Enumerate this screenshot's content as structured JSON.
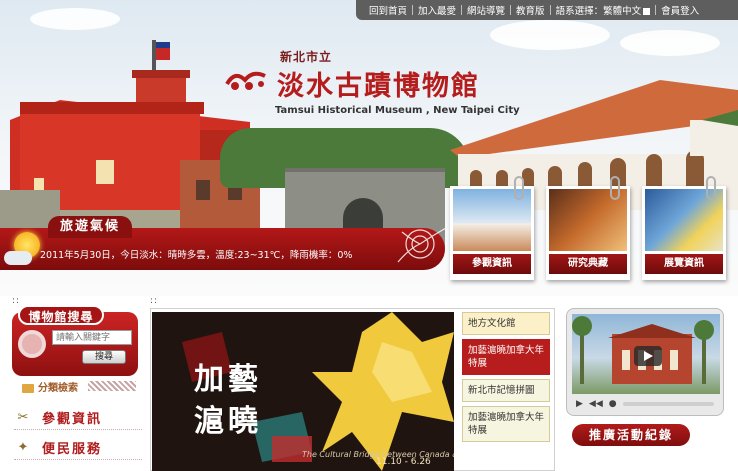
{
  "topbar": {
    "items": [
      "回到首頁",
      "加入最愛",
      "網站導覽",
      "教育版",
      "語系選擇：繁體中文",
      "會員登入"
    ]
  },
  "header": {
    "subtitle": "新北市立",
    "title": "淡水古蹟博物館",
    "title_en": "Tamsui Historical Museum , New Taipei City"
  },
  "weather": {
    "label": "旅遊氣候",
    "text": "2011年5月30日，今日淡水：晴時多雲，溫度:23~31℃，降雨機率：0%"
  },
  "features": [
    {
      "label": "參觀資訊"
    },
    {
      "label": "研究典藏"
    },
    {
      "label": "展覽資訊"
    }
  ],
  "search": {
    "title": "博物館搜尋",
    "placeholder": "請輸入關鍵字",
    "button": "搜尋",
    "category_link": "分類檢索"
  },
  "left_nav": [
    {
      "label": "參觀資訊",
      "icon": "wrench-icon"
    },
    {
      "label": "便民服務",
      "icon": "service-icon"
    }
  ],
  "hero": {
    "line1": "加藝",
    "line2": "滬曉",
    "caption": "The Cultural Bridge between Canada and",
    "dates": "11.10 - 6.26"
  },
  "tabs": [
    {
      "label": "地方文化館"
    },
    {
      "label": "加藝滬曉加拿大年特展"
    },
    {
      "label": "新北市記憶拼圖"
    },
    {
      "label": "加藝滬曉加拿大年特展"
    }
  ],
  "promo": {
    "label": "推廣活動紀錄"
  },
  "colors": {
    "brand_red": "#b81d1d",
    "topbar_gray": "#5e5e5e",
    "tab_light": "#fbf0c8"
  }
}
